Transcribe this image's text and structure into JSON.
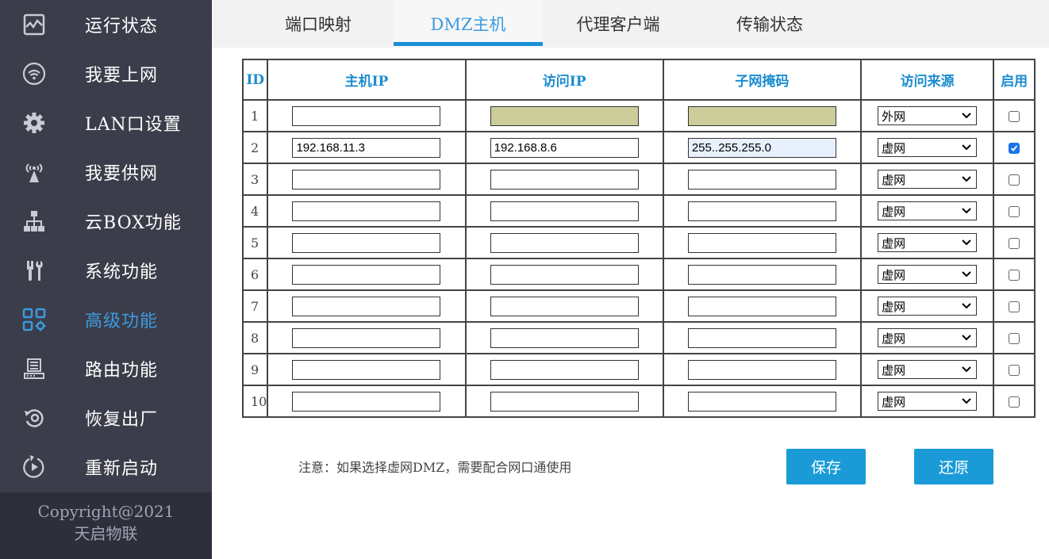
{
  "sidebar": {
    "items": [
      {
        "label": "运行状态",
        "icon": "monitor-chart-icon"
      },
      {
        "label": "我要上网",
        "icon": "wifi-icon"
      },
      {
        "label": "LAN口设置",
        "icon": "gear-icon"
      },
      {
        "label": "我要供网",
        "icon": "antenna-icon"
      },
      {
        "label": "云BOX功能",
        "icon": "network-tree-icon"
      },
      {
        "label": "系统功能",
        "icon": "tools-icon"
      },
      {
        "label": "高级功能",
        "icon": "grid-gear-icon"
      },
      {
        "label": "路由功能",
        "icon": "router-icon"
      },
      {
        "label": "恢复出厂",
        "icon": "restore-icon"
      },
      {
        "label": "重新启动",
        "icon": "restart-icon"
      }
    ],
    "active_label": "高级功能",
    "active_color": "#3b9be0",
    "copyright_line1": "Copyright@2021",
    "copyright_line2": "天启物联"
  },
  "tabs": [
    {
      "label": "端口映射"
    },
    {
      "label": "DMZ主机"
    },
    {
      "label": "代理客户端"
    },
    {
      "label": "传输状态"
    }
  ],
  "active_tab": "DMZ主机",
  "table": {
    "headers": {
      "id": "ID",
      "host_ip": "主机IP",
      "access_ip": "访问IP",
      "subnet_mask": "子网掩码",
      "source": "访问来源",
      "enable": "启用"
    },
    "rows": [
      {
        "id": "1",
        "host_ip": "",
        "access_ip": "",
        "subnet_mask": "",
        "source": "外网",
        "enabled": false
      },
      {
        "id": "2",
        "host_ip": "192.168.11.3",
        "access_ip": "192.168.8.6",
        "subnet_mask": "255..255.255.0",
        "source": "虚网",
        "enabled": true
      },
      {
        "id": "3",
        "host_ip": "",
        "access_ip": "",
        "subnet_mask": "",
        "source": "虚网",
        "enabled": false
      },
      {
        "id": "4",
        "host_ip": "",
        "access_ip": "",
        "subnet_mask": "",
        "source": "虚网",
        "enabled": false
      },
      {
        "id": "5",
        "host_ip": "",
        "access_ip": "",
        "subnet_mask": "",
        "source": "虚网",
        "enabled": false
      },
      {
        "id": "6",
        "host_ip": "",
        "access_ip": "",
        "subnet_mask": "",
        "source": "虚网",
        "enabled": false
      },
      {
        "id": "7",
        "host_ip": "",
        "access_ip": "",
        "subnet_mask": "",
        "source": "虚网",
        "enabled": false
      },
      {
        "id": "8",
        "host_ip": "",
        "access_ip": "",
        "subnet_mask": "",
        "source": "虚网",
        "enabled": false
      },
      {
        "id": "9",
        "host_ip": "",
        "access_ip": "",
        "subnet_mask": "",
        "source": "虚网",
        "enabled": false
      },
      {
        "id": "10",
        "host_ip": "",
        "access_ip": "",
        "subnet_mask": "",
        "source": "虚网",
        "enabled": false
      }
    ]
  },
  "note": "注意：如果选择虚网DMZ，需要配合网口通使用",
  "buttons": {
    "save": "保存",
    "restore": "还原"
  }
}
